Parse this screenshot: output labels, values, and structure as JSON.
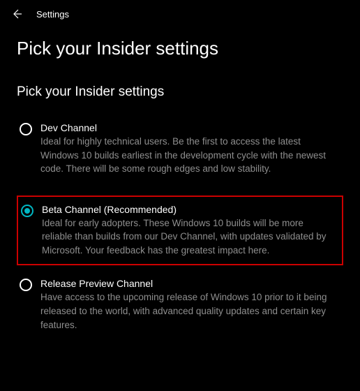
{
  "header": {
    "title": "Settings"
  },
  "page": {
    "title": "Pick your Insider settings",
    "section_title": "Pick your Insider settings"
  },
  "options": {
    "dev": {
      "label": "Dev Channel",
      "description": "Ideal for highly technical users. Be the first to access the latest Windows 10 builds earliest in the development cycle with the newest code. There will be some rough edges and low stability.",
      "selected": false
    },
    "beta": {
      "label": "Beta Channel (Recommended)",
      "description": "Ideal for early adopters. These Windows 10 builds will be more reliable than builds from our Dev Channel, with updates validated by Microsoft. Your feedback has the greatest impact here.",
      "selected": true
    },
    "release": {
      "label": "Release Preview Channel",
      "description": "Have access to the upcoming release of Windows 10 prior to it being released to the world, with advanced quality updates and certain key features.",
      "selected": false
    }
  }
}
